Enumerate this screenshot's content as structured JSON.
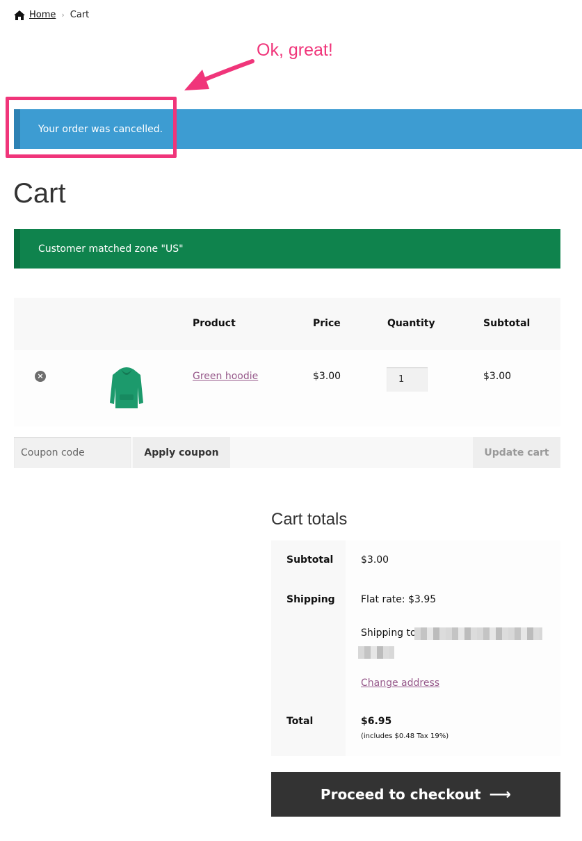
{
  "breadcrumb": {
    "home_label": "Home",
    "separator": "›",
    "current": "Cart"
  },
  "annotation": {
    "text": "Ok, great!",
    "color": "#f0357a"
  },
  "notices": {
    "info": "Your order was cancelled.",
    "success": "Customer matched zone \"US\"",
    "info_color": "#3d9cd2",
    "success_color": "#0f834d"
  },
  "page": {
    "title": "Cart"
  },
  "cart": {
    "headers": {
      "product": "Product",
      "price": "Price",
      "quantity": "Quantity",
      "subtotal": "Subtotal"
    },
    "items": [
      {
        "remove_icon": "remove-icon",
        "thumbnail": "green-hoodie-image",
        "name": "Green hoodie",
        "price": "$3.00",
        "quantity": "1",
        "subtotal": "$3.00"
      }
    ],
    "coupon_placeholder": "Coupon code",
    "apply_coupon_label": "Apply coupon",
    "update_cart_label": "Update cart"
  },
  "totals": {
    "title": "Cart totals",
    "subtotal_label": "Subtotal",
    "subtotal_value": "$3.00",
    "shipping_label": "Shipping",
    "shipping_rate": "Flat rate: $3.95",
    "shipping_to": "Shipping to",
    "change_address": "Change address",
    "total_label": "Total",
    "total_value": "$6.95",
    "tax_note": "(includes $0.48 Tax 19%)"
  },
  "checkout": {
    "label": "Proceed to checkout",
    "arrow": "⟶",
    "bg_color": "#333333"
  }
}
